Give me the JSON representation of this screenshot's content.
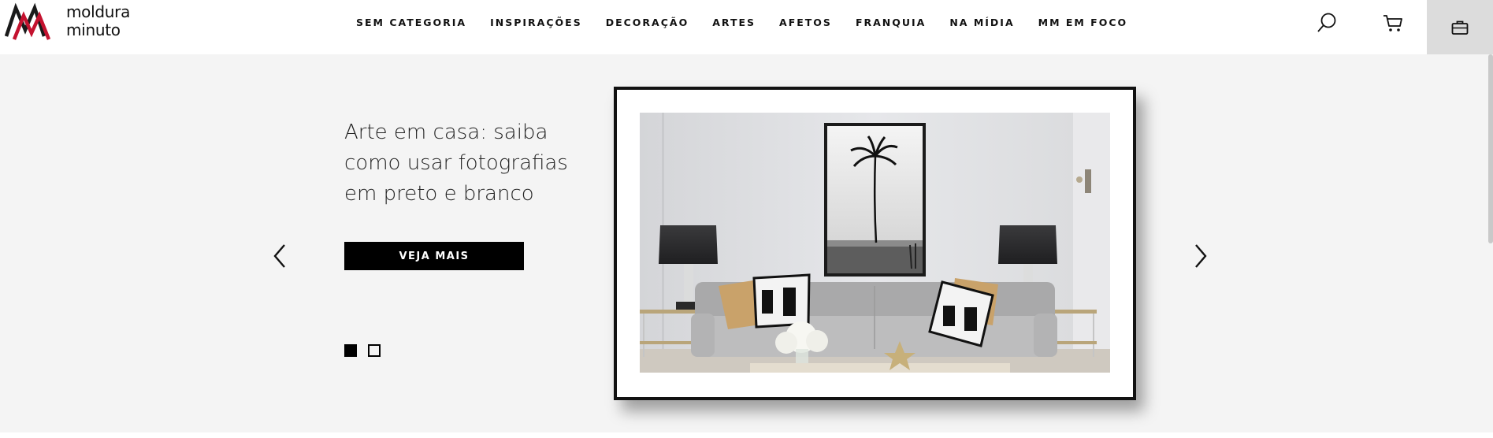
{
  "brand": {
    "line1": "moldura",
    "line2": "minuto",
    "colors": {
      "dark": "#1a1a1a",
      "red": "#c4122f"
    }
  },
  "nav": {
    "items": [
      {
        "label": "SEM CATEGORIA"
      },
      {
        "label": "INSPIRAÇÕES"
      },
      {
        "label": "DECORAÇÃO"
      },
      {
        "label": "ARTES"
      },
      {
        "label": "AFETOS"
      },
      {
        "label": "FRANQUIA"
      },
      {
        "label": "NA MÍDIA"
      },
      {
        "label": "MM EM FOCO"
      }
    ]
  },
  "header_icons": {
    "search": "search-icon",
    "cart": "cart-icon",
    "case": "briefcase-icon"
  },
  "hero": {
    "title": "Arte em casa: saiba como usar fotografias em preto e branco",
    "cta_label": "VEJA MAIS",
    "slides": 2,
    "active_slide": 1,
    "image": "living-room-with-framed-palm-tree-photo"
  }
}
